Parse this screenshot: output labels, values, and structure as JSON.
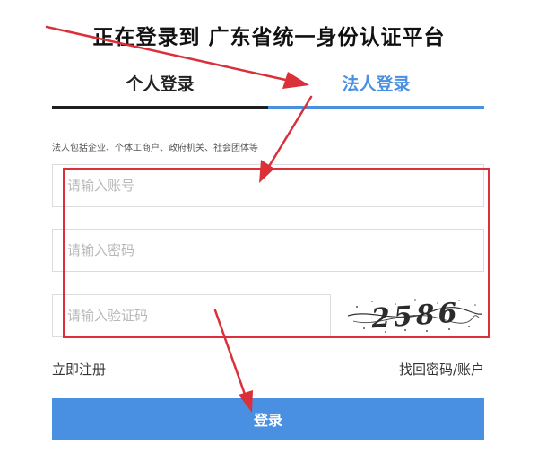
{
  "page": {
    "title": "正在登录到 广东省统一身份认证平台"
  },
  "tabs": [
    {
      "label": "个人登录",
      "active": false
    },
    {
      "label": "法人登录",
      "active": true
    }
  ],
  "form": {
    "hint": "法人包括企业、个体工商户、政府机关、社会团体等",
    "account_placeholder": "请输入账号",
    "password_placeholder": "请输入密码",
    "captcha_placeholder": "请输入验证码",
    "captcha_text": "2586"
  },
  "links": {
    "register": "立即注册",
    "recover": "找回密码/账户"
  },
  "buttons": {
    "login": "登录"
  },
  "colors": {
    "accent": "#4a90e2",
    "annotation": "#d9303a",
    "inactive_tab_border": "#1f1f1f"
  }
}
